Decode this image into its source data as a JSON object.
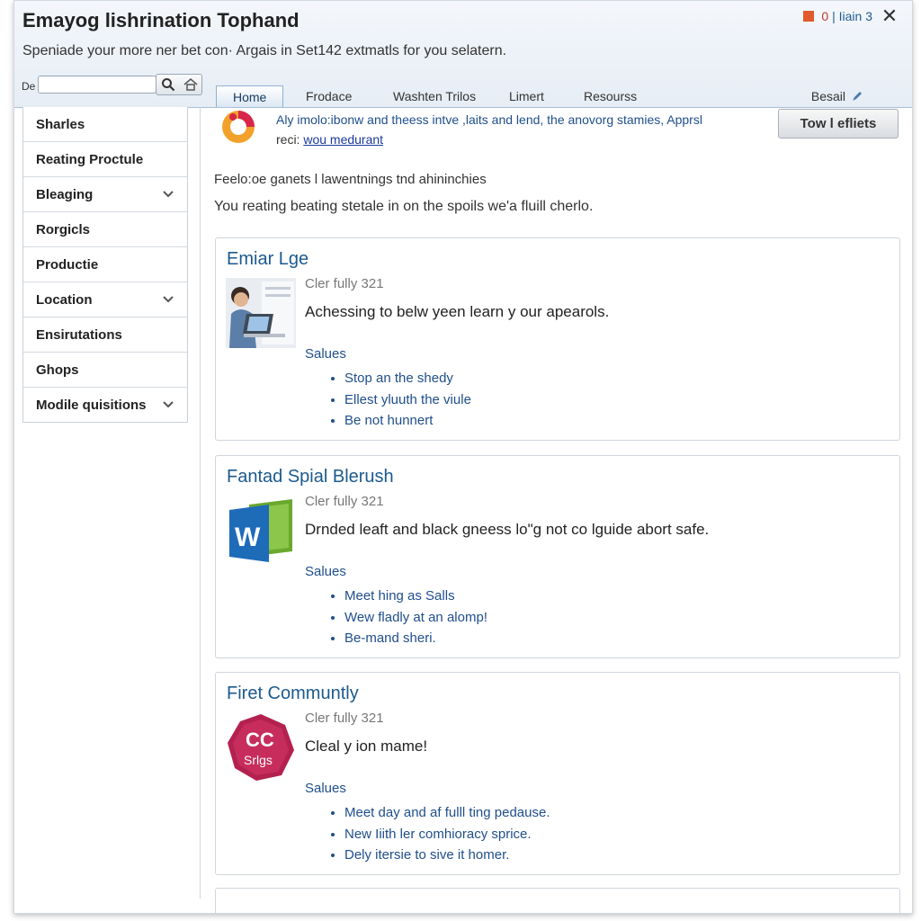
{
  "window": {
    "title": "Emayog lishrination Tophand",
    "subtitle": "Speniade your more ner bet con· Argais in Set142 extmatls for you selatern.",
    "status_number": "0",
    "status_label": "Iiain 3",
    "close_label": "✕"
  },
  "search": {
    "label": "De",
    "value": "",
    "placeholder": ""
  },
  "tabs": [
    {
      "label": "Home",
      "active": true
    },
    {
      "label": "Frodace"
    },
    {
      "label": "Washten Trilos"
    },
    {
      "label": "Limert"
    },
    {
      "label": "Resourss"
    }
  ],
  "tab_right": {
    "label": "Besail"
  },
  "sidebar": {
    "items": [
      {
        "label": "Sharles"
      },
      {
        "label": "Reating Proctule"
      },
      {
        "label": "Bleaging",
        "chevron": true
      },
      {
        "label": "Rorgicls"
      },
      {
        "label": "Productie"
      },
      {
        "label": "Location",
        "chevron": true
      },
      {
        "label": "Ensirutations"
      },
      {
        "label": "Ghops"
      },
      {
        "label": "Modile quisitions",
        "chevron": true
      }
    ]
  },
  "notice": {
    "line1": "Aly imolo:ibonw and theess intve ,laits and lend, the anovorg stamies, Apprsl",
    "line2_prefix": "reci:",
    "link": "wou medurant",
    "button": "Tow l efliets"
  },
  "intro": {
    "line1": "Feelo:oe ganets l lawentnings tnd ahininchies",
    "line2": "You reating beating stetale in on the spoils we'a fluill cherlo."
  },
  "cards": [
    {
      "title": "Emiar Lge",
      "meta": "Cler fully 321",
      "desc": "Achessing to belw yeen learn y our apearols.",
      "sub": "Salues",
      "items": [
        "Stop an the shedy",
        "Ellest yluuth the viule",
        "Be not hunnert"
      ]
    },
    {
      "title": "Fantad Spial Blerush",
      "meta": "Cler fully 321",
      "desc": "Drnded leaft and black gneess lo\"g not co lguide abort safe.",
      "sub": "Salues",
      "items": [
        "Meet hing as Salls",
        "Wew fladly at an alomp!",
        "Be-mand sheri."
      ]
    },
    {
      "title": "Firet Communtly",
      "meta": "Cler fully 321",
      "desc": "Cleal y ion mame!",
      "sub": "Salues",
      "items": [
        "Meet day and af fulll ting pedause.",
        "New Iiith ler comhioracy sprice.",
        "Dely itersie to sive it homer."
      ]
    }
  ],
  "icons": {
    "flag": "flag-icon",
    "close": "close-icon",
    "search": "search-icon",
    "home": "home-icon",
    "chevron": "chevron-down-icon",
    "notice_logo": "app-logo-icon",
    "card1_thumb": "person-laptop-thumbnail",
    "card2_thumb": "word-document-icon",
    "card3_thumb": "cc-badge-icon"
  },
  "colors": {
    "accent_blue": "#1c5a8e",
    "link_blue": "#1a3a9a",
    "header_bg": "#e6edf5",
    "word_blue": "#1e6bb8",
    "word_green": "#6aa82e",
    "badge_crimson": "#b3214f"
  }
}
